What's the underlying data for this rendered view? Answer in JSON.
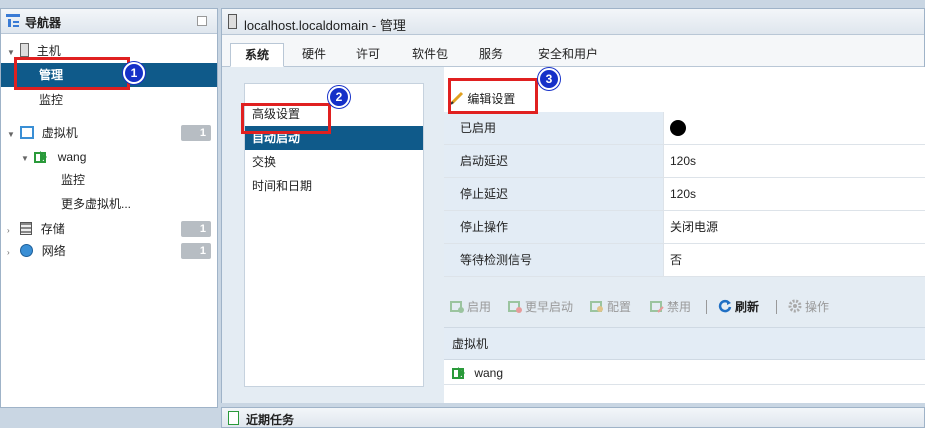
{
  "navigator": {
    "title": "导航器",
    "host": "主机",
    "host_manage": "管理",
    "host_monitor": "监控",
    "vms": "虚拟机",
    "vms_count": "1",
    "vm_name": "wang",
    "vm_monitor": "监控",
    "more_vms": "更多虚拟机...",
    "storage": "存储",
    "storage_count": "1",
    "network": "网络",
    "network_count": "1"
  },
  "main": {
    "title": "localhost.localdomain - 管理",
    "tabs": [
      "系统",
      "硬件",
      "许可",
      "软件包",
      "服务",
      "安全和用户"
    ],
    "active_tab": "系统",
    "subnav": [
      "高级设置",
      "自动启动",
      "交换",
      "时间和日期"
    ],
    "edit_settings": "编辑设置",
    "properties": [
      {
        "key": "已启用",
        "value": ""
      },
      {
        "key": "启动延迟",
        "value": "120s"
      },
      {
        "key": "停止延迟",
        "value": "120s"
      },
      {
        "key": "停止操作",
        "value": "关闭电源"
      },
      {
        "key": "等待检测信号",
        "value": "否"
      }
    ],
    "toolbar": {
      "enable": "启用",
      "start_earlier": "更早启动",
      "configure": "配置",
      "disable": "禁用",
      "refresh": "刷新",
      "actions": "操作"
    },
    "vm_table": {
      "header": "虚拟机",
      "rows": [
        "wang"
      ]
    }
  },
  "recent_tasks": {
    "title": "近期任务"
  },
  "annotations": [
    "1",
    "2",
    "3"
  ],
  "colors": {
    "selection": "#0f5a8a",
    "annotation_red": "#e02020",
    "badge_blue": "#1530c8"
  }
}
